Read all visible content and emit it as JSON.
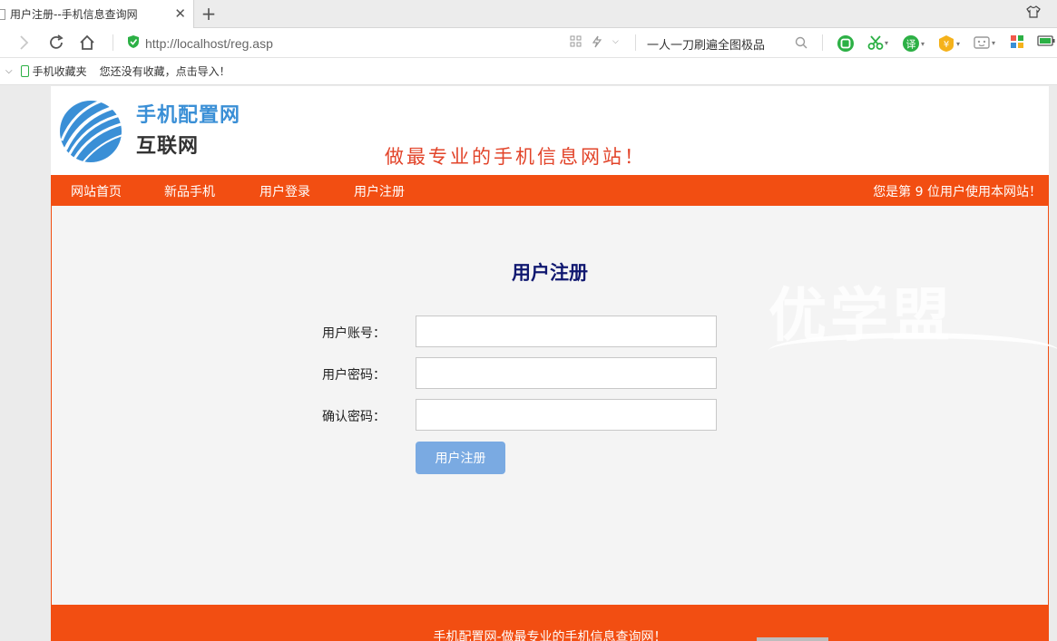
{
  "browser": {
    "tab_title": "用户注册--手机信息查询网",
    "url_host": "http://localhost",
    "url_path": "/reg.asp",
    "search_text": "一人一刀刷遍全图极品",
    "bookmarks_label": "手机收藏夹",
    "bookmarks_hint": "您还没有收藏，点击导入！"
  },
  "site": {
    "logo_name": "手机配置网",
    "logo_sub": "互联网",
    "slogan": "做最专业的手机信息网站！",
    "nav": [
      {
        "label": "网站首页"
      },
      {
        "label": "新品手机"
      },
      {
        "label": "用户登录"
      },
      {
        "label": "用户注册"
      }
    ],
    "visitor_text": "您是第 9 位用户使用本网站！",
    "footer_text": "手机配置网-做最专业的手机信息查询网！"
  },
  "form": {
    "title": "用户注册",
    "account_label": "用户账号：",
    "password_label": "用户密码：",
    "confirm_label": "确认密码：",
    "account_value": "",
    "password_value": "",
    "confirm_value": "",
    "submit_label": "用户注册"
  },
  "watermark": "优学盟",
  "colors": {
    "nav_bg": "#f24e12",
    "title": "#101870",
    "button": "#7aaae2",
    "logo_blue": "#3a8fd6",
    "slogan": "#e2442a"
  }
}
